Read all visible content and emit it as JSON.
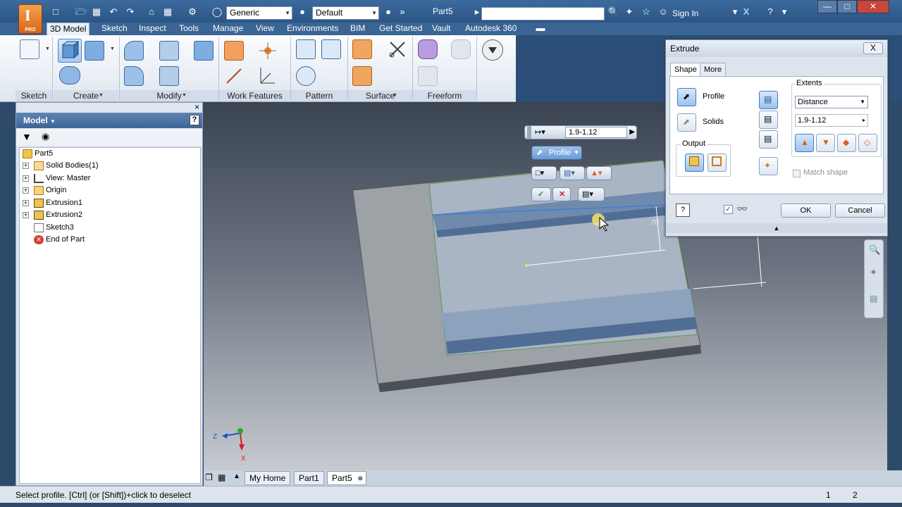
{
  "window": {
    "document_title": "Part5",
    "material": "Generic",
    "appearance": "Default",
    "sign_in": "Sign In",
    "logo_letter": "I",
    "logo_edition": "PRO"
  },
  "ribbon_tabs": [
    "3D Model",
    "Sketch",
    "Inspect",
    "Tools",
    "Manage",
    "View",
    "Environments",
    "BIM",
    "Get Started",
    "Vault",
    "Autodesk 360"
  ],
  "ribbon_panels": [
    "Sketch",
    "Create",
    "Modify",
    "Work Features",
    "Pattern",
    "Surface",
    "Freeform"
  ],
  "browser": {
    "title": "Model",
    "help": "?",
    "close": "×",
    "tree": [
      {
        "label": "Part5",
        "expandable": false
      },
      {
        "label": "Solid Bodies(1)",
        "expandable": true
      },
      {
        "label": "View: Master",
        "expandable": true
      },
      {
        "label": "Origin",
        "expandable": true
      },
      {
        "label": "Extrusion1",
        "expandable": true
      },
      {
        "label": "Extrusion2",
        "expandable": true
      },
      {
        "label": "Sketch3",
        "expandable": false
      },
      {
        "label": "End of Part",
        "expandable": false
      }
    ]
  },
  "minitoolbar": {
    "distance": "1.9-1.12",
    "profile_label": "Profile"
  },
  "viewport": {
    "dimension_text": ".70",
    "axis_z": "Z",
    "axis_x": "X"
  },
  "extrude_dialog": {
    "title": "Extrude",
    "close": "X",
    "tabs": [
      "Shape",
      "More"
    ],
    "profile_label": "Profile",
    "solids_label": "Solids",
    "output_label": "Output",
    "extents_label": "Extents",
    "extents_type": "Distance",
    "distance_value": "1.9-1.12",
    "match_shape": "Match shape",
    "ok": "OK",
    "cancel": "Cancel",
    "help": "?"
  },
  "doc_tabs": [
    "My Home",
    "Part1",
    "Part5"
  ],
  "status": {
    "message": "Select profile. [Ctrl] (or [Shift])+click to deselect",
    "count1": "1",
    "count2": "2"
  },
  "colors": {
    "accent": "#3a6494",
    "selection": "#4e84c2",
    "face_highlight": "#8fa9c8"
  }
}
